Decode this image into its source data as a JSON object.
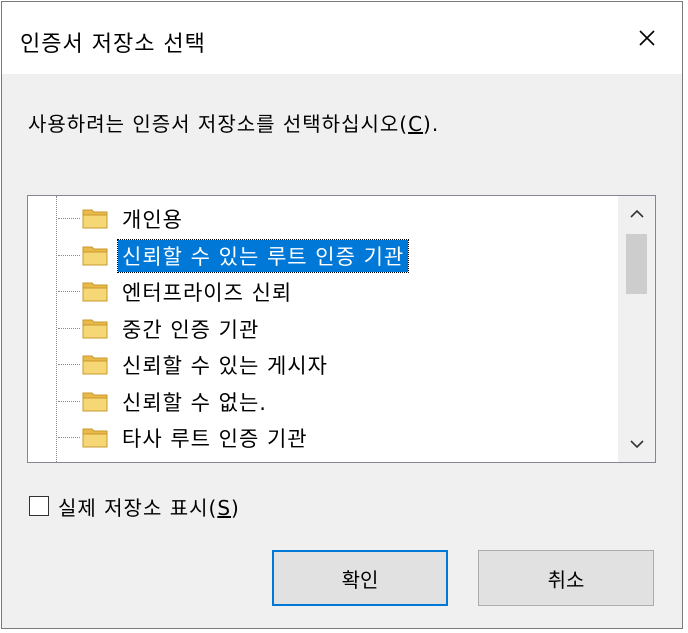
{
  "window": {
    "title": "인증서 저장소 선택",
    "close_icon": "close-icon"
  },
  "instruction": {
    "text": "사용하려는 인증서 저장소를 선택하십시오(",
    "accel": "C",
    "suffix": ")."
  },
  "tree": {
    "items": [
      {
        "label": "개인용",
        "selected": false
      },
      {
        "label": "신뢰할 수 있는 루트 인증 기관",
        "selected": true
      },
      {
        "label": "엔터프라이즈 신뢰",
        "selected": false
      },
      {
        "label": "중간 인증 기관",
        "selected": false
      },
      {
        "label": "신뢰할 수 있는 게시자",
        "selected": false
      },
      {
        "label": "신뢰할 수 없는.",
        "selected": false
      },
      {
        "label": "타사 루트 인증 기관",
        "selected": false
      }
    ],
    "folder_icon": "folder-icon",
    "selection_color": "#0078d7"
  },
  "checkbox": {
    "label": "실제 저장소 표시(",
    "accel": "S",
    "suffix": ")",
    "checked": false
  },
  "buttons": {
    "ok": "확인",
    "cancel": "취소"
  },
  "colors": {
    "accent": "#0078d7",
    "dialog_bg": "#f0f0f0",
    "folder": "#f6d776"
  }
}
